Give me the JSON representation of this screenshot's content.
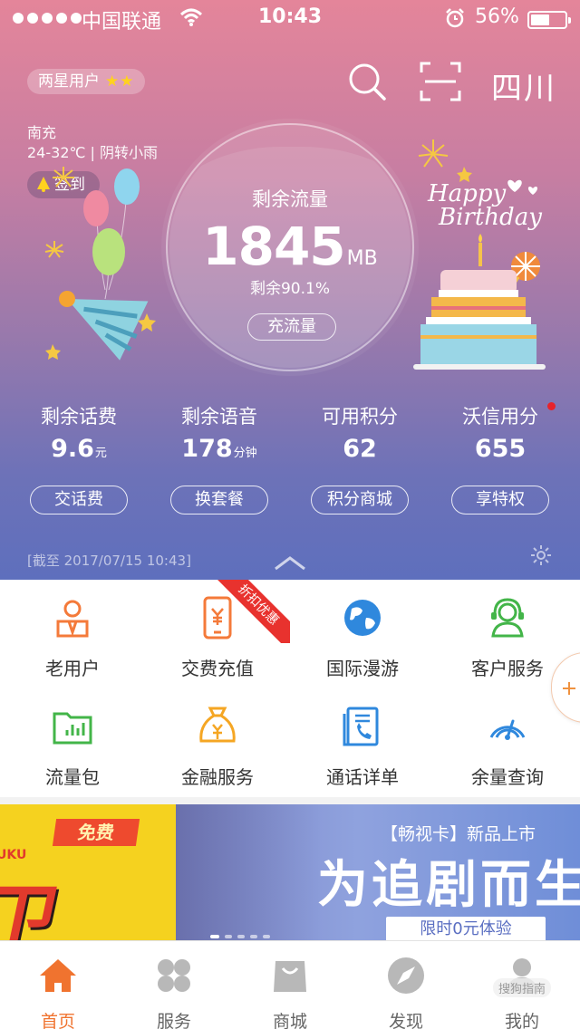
{
  "status_bar": {
    "carrier": "中国联通",
    "time": "10:43",
    "battery": "56%",
    "battery_level": 0.56
  },
  "header": {
    "user_level": "两星用户",
    "stars": "★★",
    "province": "四川",
    "icons": [
      "search-icon",
      "scan-icon"
    ]
  },
  "weather": {
    "city": "南充",
    "forecast": "24-32℃ | 阴转小雨"
  },
  "checkin_label": "签到",
  "data_usage": {
    "label": "剩余流量",
    "value": "1845",
    "unit": "MB",
    "percent": "剩余90.1%",
    "button": "充流量"
  },
  "stats": [
    {
      "label": "剩余话费",
      "value": "9.6",
      "unit": "元",
      "button": "交话费"
    },
    {
      "label": "剩余语音",
      "value": "178",
      "unit": "分钟",
      "button": "换套餐"
    },
    {
      "label": "可用积分",
      "value": "62",
      "unit": "",
      "button": "积分商城"
    },
    {
      "label": "沃信用分",
      "value": "655",
      "unit": "",
      "button": "享特权"
    }
  ],
  "update_time": "[截至 2017/07/15 10:43]",
  "services": [
    {
      "label": "老用户",
      "icon": "user-badge-icon"
    },
    {
      "label": "交费充值",
      "icon": "phone-yuan-icon"
    },
    {
      "label": "国际漫游",
      "icon": "globe-icon"
    },
    {
      "label": "客户服务",
      "icon": "headset-icon"
    },
    {
      "label": "流量包",
      "icon": "folder-chart-icon"
    },
    {
      "label": "金融服务",
      "icon": "money-bag-icon"
    },
    {
      "label": "通话详单",
      "icon": "call-list-icon"
    },
    {
      "label": "余量查询",
      "icon": "gauge-icon"
    }
  ],
  "promo_ribbon": "折扣优惠",
  "banner": {
    "left_badge": "免费",
    "left_brand": "UKU",
    "left_char": "卫",
    "right_subtitle": "【畅视卡】新品上市",
    "right_headline": "为追剧而生",
    "right_button": "限时0元体验"
  },
  "tabbar": [
    {
      "label": "首页",
      "icon": "home-icon",
      "active": true
    },
    {
      "label": "服务",
      "icon": "grid-icon",
      "active": false
    },
    {
      "label": "商城",
      "icon": "shopping-bag-icon",
      "active": false
    },
    {
      "label": "发现",
      "icon": "compass-icon",
      "active": false
    },
    {
      "label": "我的",
      "icon": "person-icon",
      "active": false
    }
  ],
  "watermark": "搜狗指南",
  "colors": {
    "accent": "#f0732f",
    "service_orange": "#f47a3a",
    "service_blue": "#2f88dd",
    "service_green": "#43b549",
    "service_yellow": "#f5a623",
    "notice_red": "#e8232a"
  }
}
